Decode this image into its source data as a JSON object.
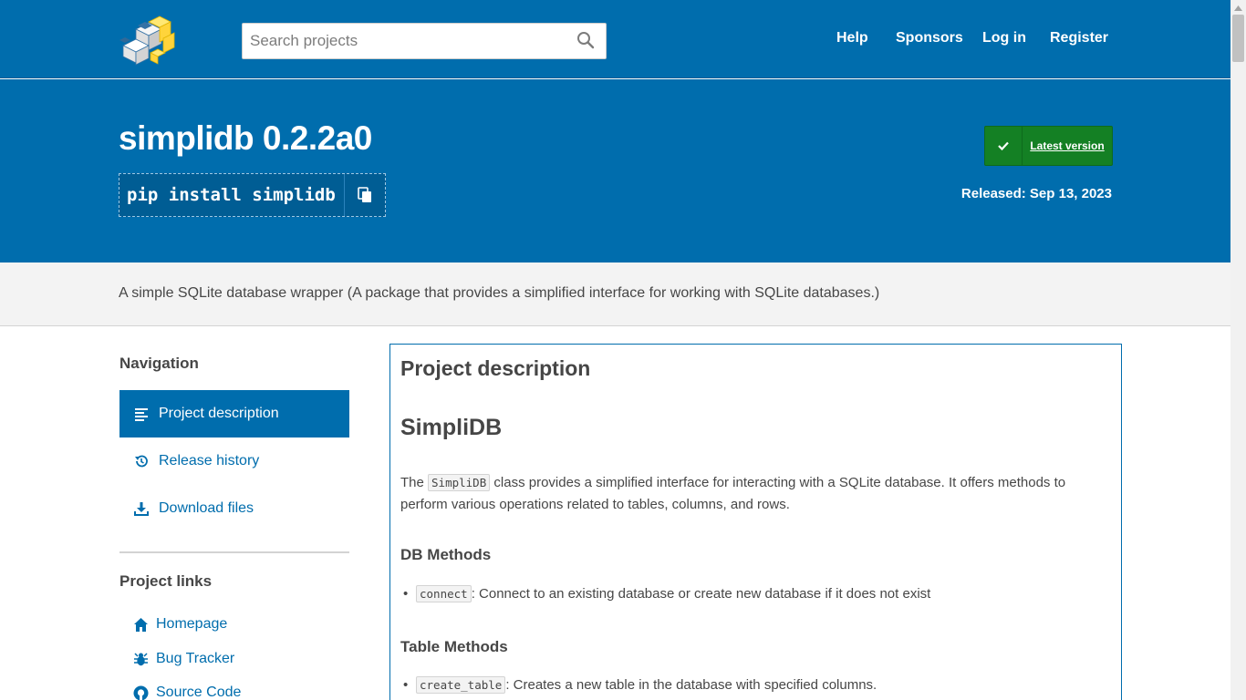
{
  "header": {
    "logo_icon": "pypi-cubes-logo",
    "search": {
      "placeholder": "Search projects"
    },
    "nav": [
      "Help",
      "Sponsors",
      "Log in",
      "Register"
    ]
  },
  "banner": {
    "title": "simplidb 0.2.2a0",
    "pip_command": "pip install simplidb",
    "latest_label": "Latest version",
    "released": "Released: Sep 13, 2023"
  },
  "summary": "A simple SQLite database wrapper (A package that provides a simplified interface for working with SQLite databases.)",
  "sidebar": {
    "nav_heading": "Navigation",
    "nav_items": [
      {
        "label": "Project description",
        "icon": "align-left-icon",
        "active": true
      },
      {
        "label": "Release history",
        "icon": "history-icon",
        "active": false
      },
      {
        "label": "Download files",
        "icon": "download-icon",
        "active": false
      }
    ],
    "links_heading": "Project links",
    "links": [
      {
        "label": "Homepage",
        "icon": "home-icon"
      },
      {
        "label": "Bug Tracker",
        "icon": "bug-icon"
      },
      {
        "label": "Source Code",
        "icon": "github-icon"
      }
    ]
  },
  "description": {
    "heading": "Project description",
    "title": "SimpliDB",
    "intro_pre": "The ",
    "intro_code": "SimpliDB",
    "intro_post": " class provides a simplified interface for interacting with a SQLite database. It offers methods to perform various operations related to tables, columns, and rows.",
    "sections": [
      {
        "heading": "DB Methods",
        "items": [
          {
            "code": "connect",
            "text": ": Connect to an existing database or create new database if it does not exist"
          }
        ]
      },
      {
        "heading": "Table Methods",
        "items": [
          {
            "code": "create_table",
            "text": ": Creates a new table in the database with specified columns."
          }
        ]
      }
    ]
  },
  "colors": {
    "primary": "#006dad",
    "success": "#148024",
    "text": "#464646"
  }
}
